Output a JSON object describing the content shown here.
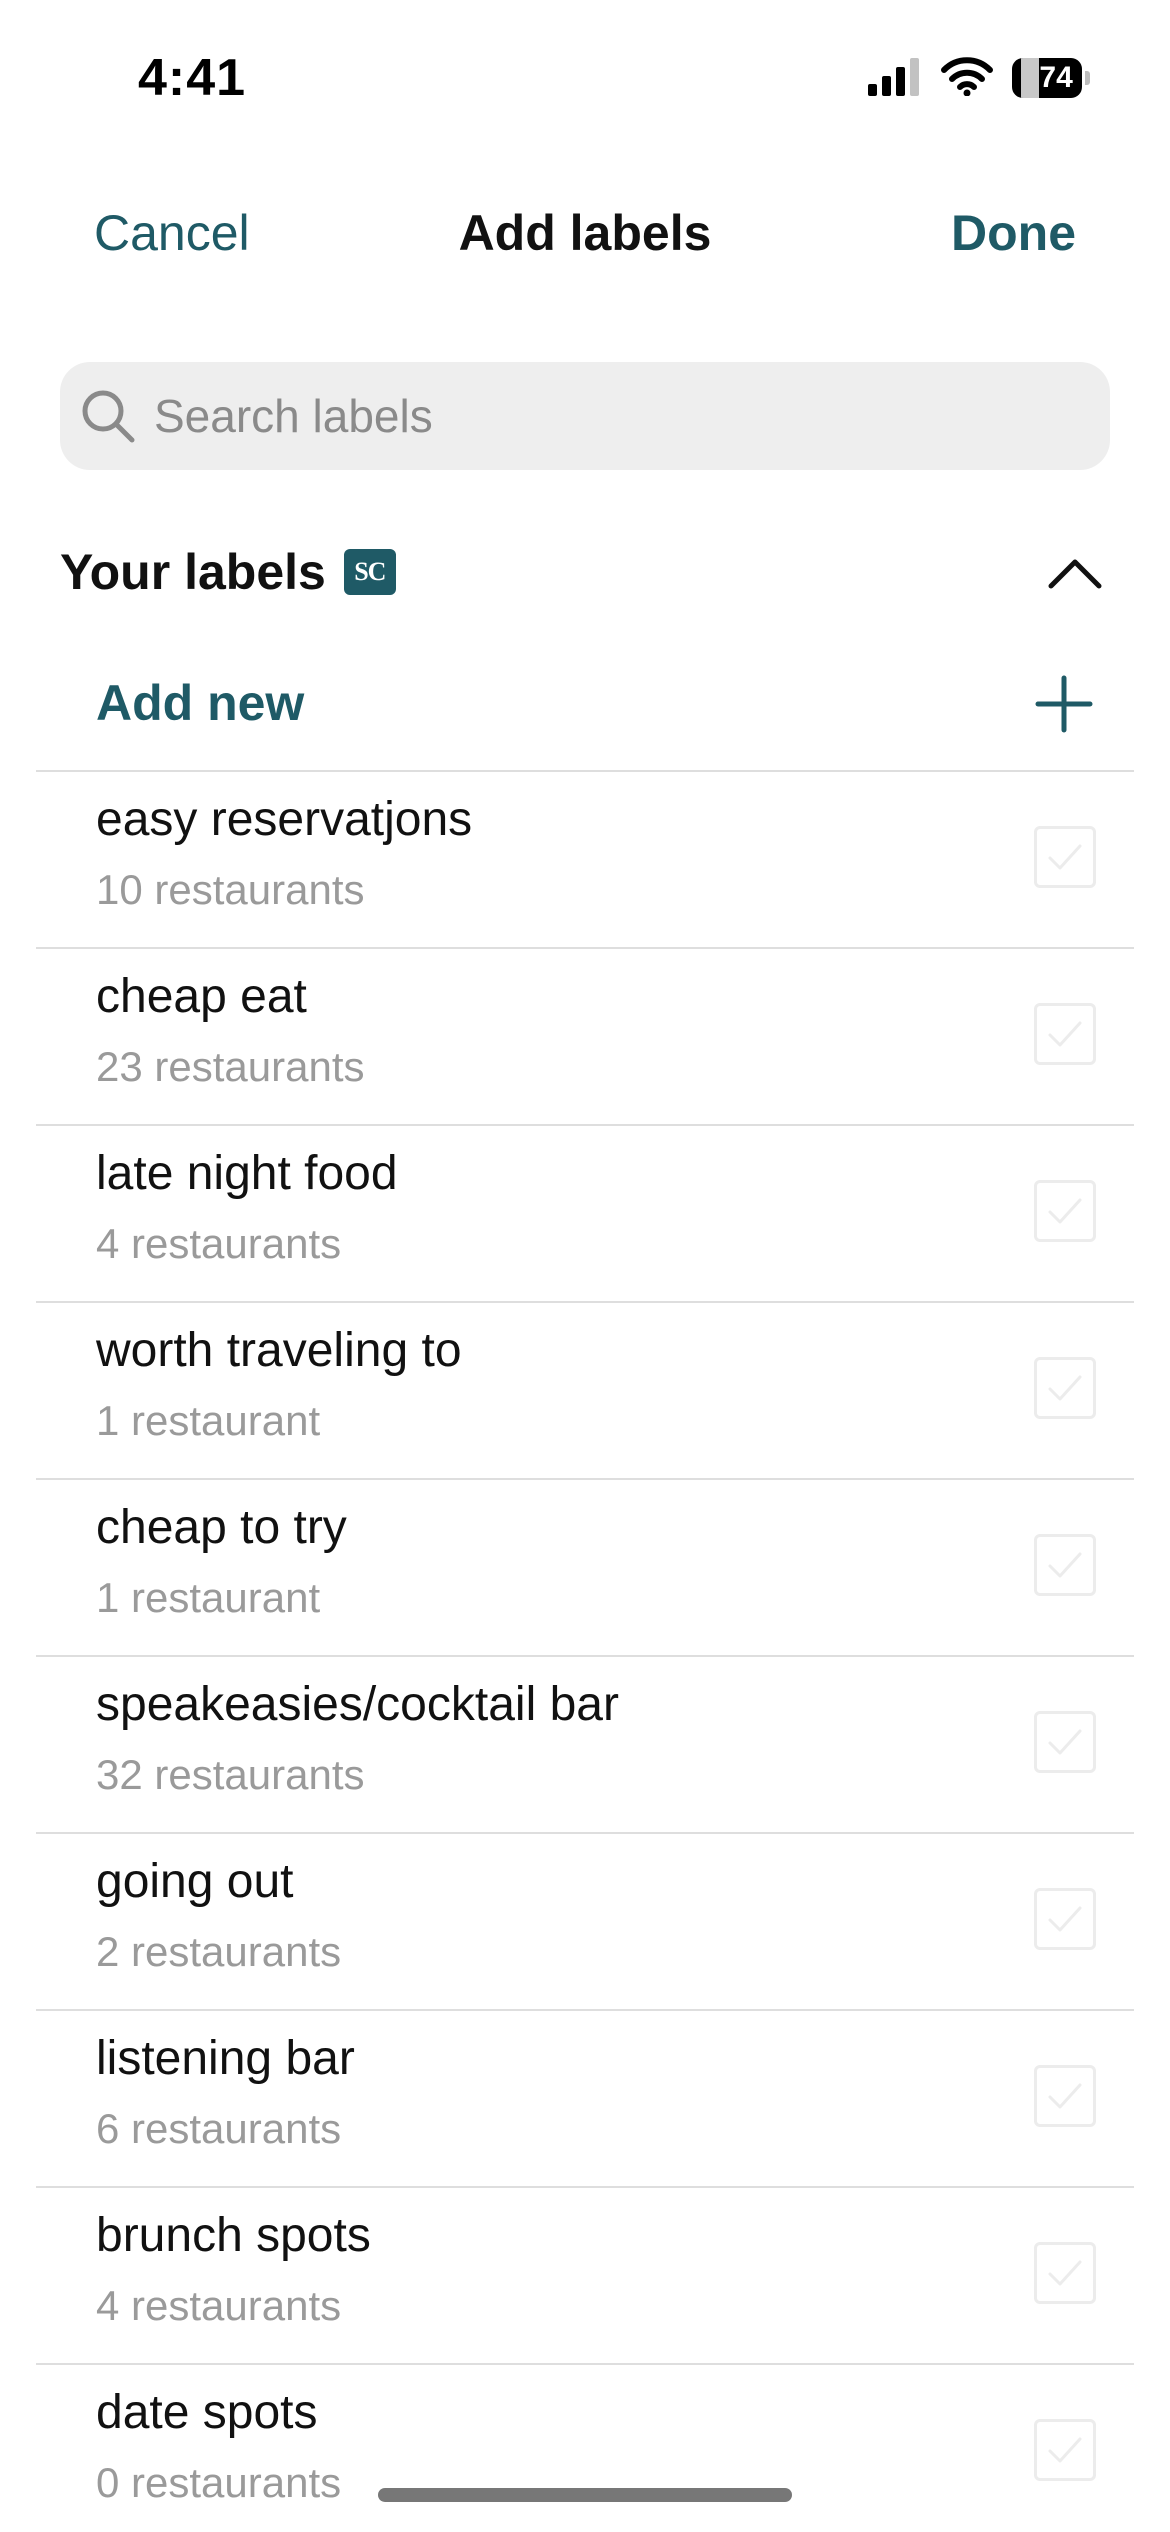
{
  "status_bar": {
    "time": "4:41",
    "battery_level": "74",
    "battery_fraction": 0.74,
    "icons": [
      "signal-icon",
      "wifi-icon",
      "battery-icon"
    ]
  },
  "header": {
    "cancel_label": "Cancel",
    "title": "Add labels",
    "done_label": "Done"
  },
  "search": {
    "placeholder": "Search labels",
    "value": ""
  },
  "section": {
    "title": "Your labels",
    "badge": "SC",
    "add_new_label": "Add new"
  },
  "labels": [
    {
      "name": "easy reservatjons",
      "count": "10 restaurants",
      "checked": false
    },
    {
      "name": "cheap eat",
      "count": "23 restaurants",
      "checked": false
    },
    {
      "name": "late night food",
      "count": "4 restaurants",
      "checked": false
    },
    {
      "name": "worth traveling to",
      "count": "1 restaurant",
      "checked": false
    },
    {
      "name": "cheap to try",
      "count": "1 restaurant",
      "checked": false
    },
    {
      "name": "speakeasies/cocktail bar",
      "count": "32 restaurants",
      "checked": false
    },
    {
      "name": "going out",
      "count": "2 restaurants",
      "checked": false
    },
    {
      "name": "listening bar",
      "count": "6 restaurants",
      "checked": false
    },
    {
      "name": "brunch spots",
      "count": "4 restaurants",
      "checked": false
    },
    {
      "name": "date spots",
      "count": "0 restaurants",
      "checked": false
    }
  ],
  "colors": {
    "accent": "#1f5a66",
    "divider": "#dedede",
    "secondary_text": "#9a9a9a",
    "search_bg": "#eeeeee"
  }
}
